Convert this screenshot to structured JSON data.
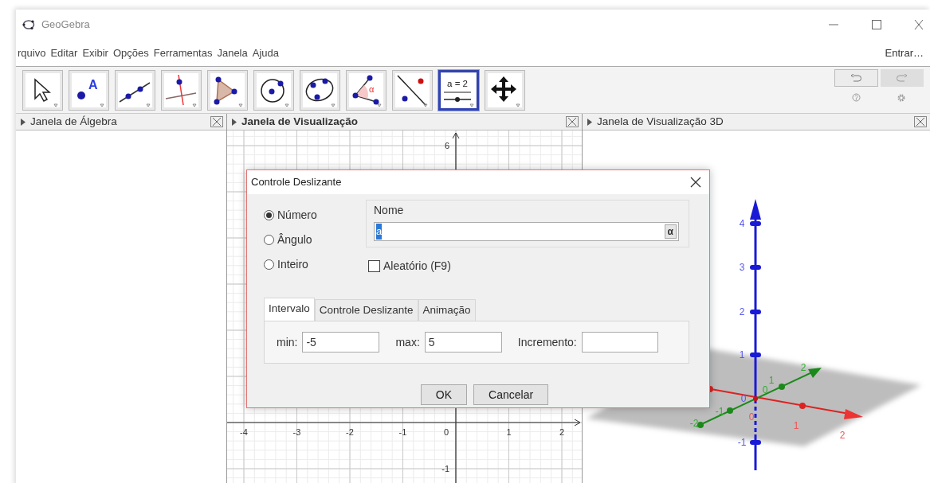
{
  "window": {
    "title": "GeoGebra"
  },
  "menu": [
    {
      "label": "rquivo"
    },
    {
      "label": "Editar"
    },
    {
      "label": "Exibir"
    },
    {
      "label": "Opções"
    },
    {
      "label": "Ferramentas"
    },
    {
      "label": "Janela"
    },
    {
      "label": "Ajuda"
    }
  ],
  "login": "Entrar…",
  "toolbar": [
    {
      "kind": "pointer",
      "selected": false
    },
    {
      "kind": "point",
      "glyph": "A",
      "selected": false
    },
    {
      "kind": "line",
      "selected": false
    },
    {
      "kind": "perpendicular",
      "selected": false
    },
    {
      "kind": "polygon",
      "selected": false
    },
    {
      "kind": "circle",
      "selected": false
    },
    {
      "kind": "ellipse",
      "selected": false
    },
    {
      "kind": "angle",
      "glyph": "α",
      "selected": false
    },
    {
      "kind": "reflect",
      "selected": false
    },
    {
      "kind": "slider",
      "glyph": "a = 2",
      "selected": true
    },
    {
      "kind": "move-view",
      "selected": false
    }
  ],
  "panels": [
    {
      "title": "Janela de Álgebra",
      "focused": false
    },
    {
      "title": "Janela de Visualização",
      "focused": true
    },
    {
      "title": "Janela de Visualização 3D",
      "focused": false
    }
  ],
  "graphics_2d": {
    "x_tick_labels": [
      "-4",
      "-3",
      "-2",
      "-1",
      "0",
      "1",
      "2"
    ],
    "y_tick_labels": [
      {
        "label": "6",
        "kind": "top"
      },
      {
        "label": "-1",
        "kind": "bottom"
      }
    ]
  },
  "graphics_3d": {
    "z_tick_labels": [
      "4",
      "3",
      "2",
      "1",
      "-1"
    ],
    "z_origin_label": "0",
    "x_tick_labels": [
      "0",
      "1",
      "2"
    ],
    "y_tick_labels": [
      "-2",
      "-1",
      "1",
      "2"
    ],
    "y_origin_label": "0"
  },
  "dialog": {
    "title": "Controle Deslizante",
    "types": [
      {
        "label": "Número",
        "selected": true
      },
      {
        "label": "Ângulo",
        "selected": false
      },
      {
        "label": "Inteiro",
        "selected": false
      }
    ],
    "name_group": {
      "label": "Nome",
      "value": "a",
      "symbol_button": "α"
    },
    "random": {
      "label": "Aleatório (F9)",
      "checked": false
    },
    "tabs": [
      {
        "label": "Intervalo",
        "selected": true
      },
      {
        "label": "Controle Deslizante",
        "selected": false
      },
      {
        "label": "Animação",
        "selected": false
      }
    ],
    "fields": [
      {
        "label": "min:",
        "value": "-5"
      },
      {
        "label": "max:",
        "value": "5"
      },
      {
        "label": "Incremento:"
      }
    ],
    "buttons": [
      "OK",
      "Cancelar"
    ]
  }
}
